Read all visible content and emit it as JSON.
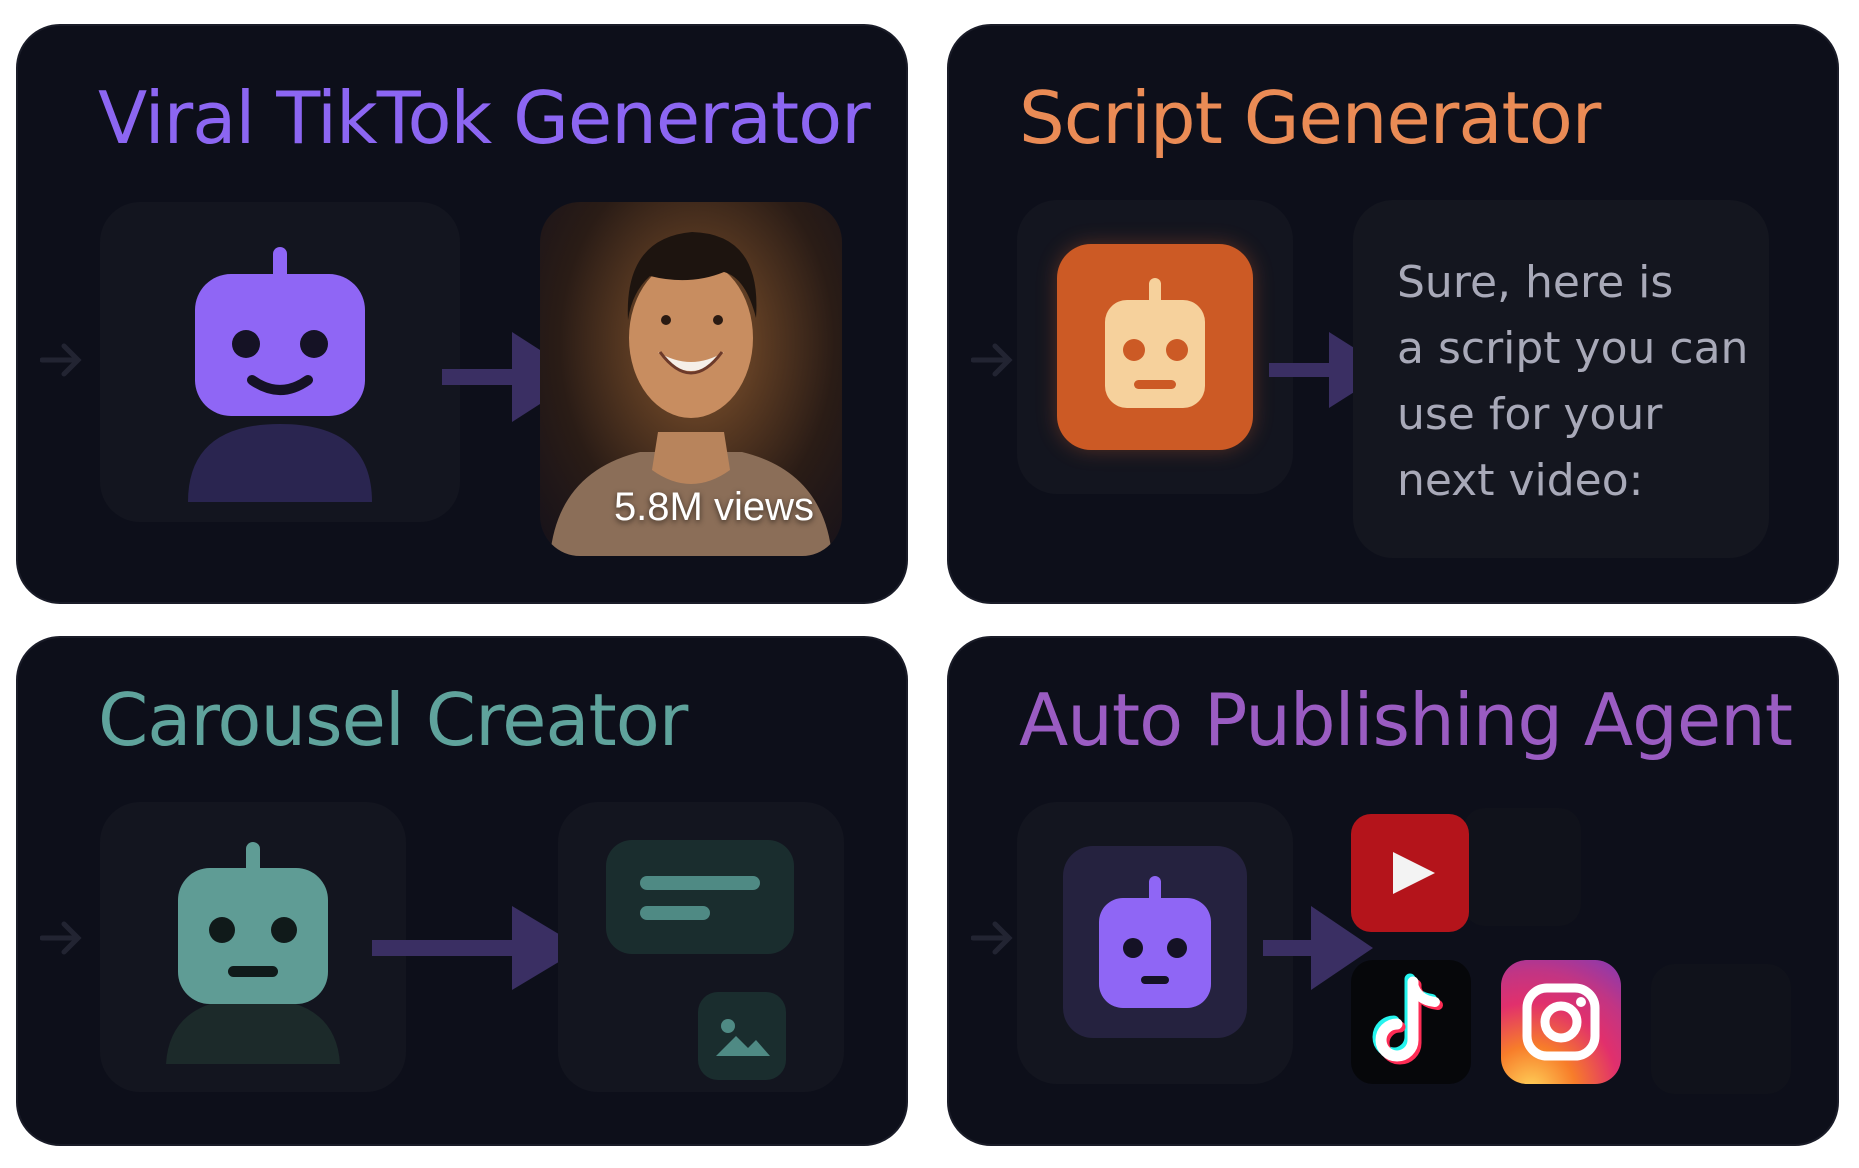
{
  "cards": [
    {
      "id": "viral-tiktok",
      "title": "Viral TikTok Generator",
      "title_color": "#8c66f2",
      "media_caption": "5.8M views"
    },
    {
      "id": "script",
      "title": "Script Generator",
      "title_color": "#ea8b55",
      "script_lines": [
        "Sure, here is",
        "a script you can",
        "use for your",
        "next video:"
      ]
    },
    {
      "id": "carousel",
      "title": "Carousel Creator",
      "title_color": "#5fa39c"
    },
    {
      "id": "auto-publish",
      "title": "Auto Publishing Agent",
      "title_color": "#9a5cc2",
      "platforms": [
        "youtube",
        "tiktok",
        "instagram"
      ]
    }
  ],
  "icons": [
    "robot-icon",
    "arrow-right-icon",
    "play-icon",
    "tiktok-icon",
    "instagram-icon",
    "image-icon",
    "text-lines-icon"
  ],
  "colors": {
    "card_bg": "#0d0f1a",
    "tile_bg": "#13151f",
    "arrow": "#3a2f63",
    "robot_purple": "#8f66f5",
    "robot_orange_bg": "#cc5a25",
    "robot_orange_face": "#f6d19c",
    "robot_teal": "#5f9c95",
    "youtube_red": "#b4141b"
  }
}
